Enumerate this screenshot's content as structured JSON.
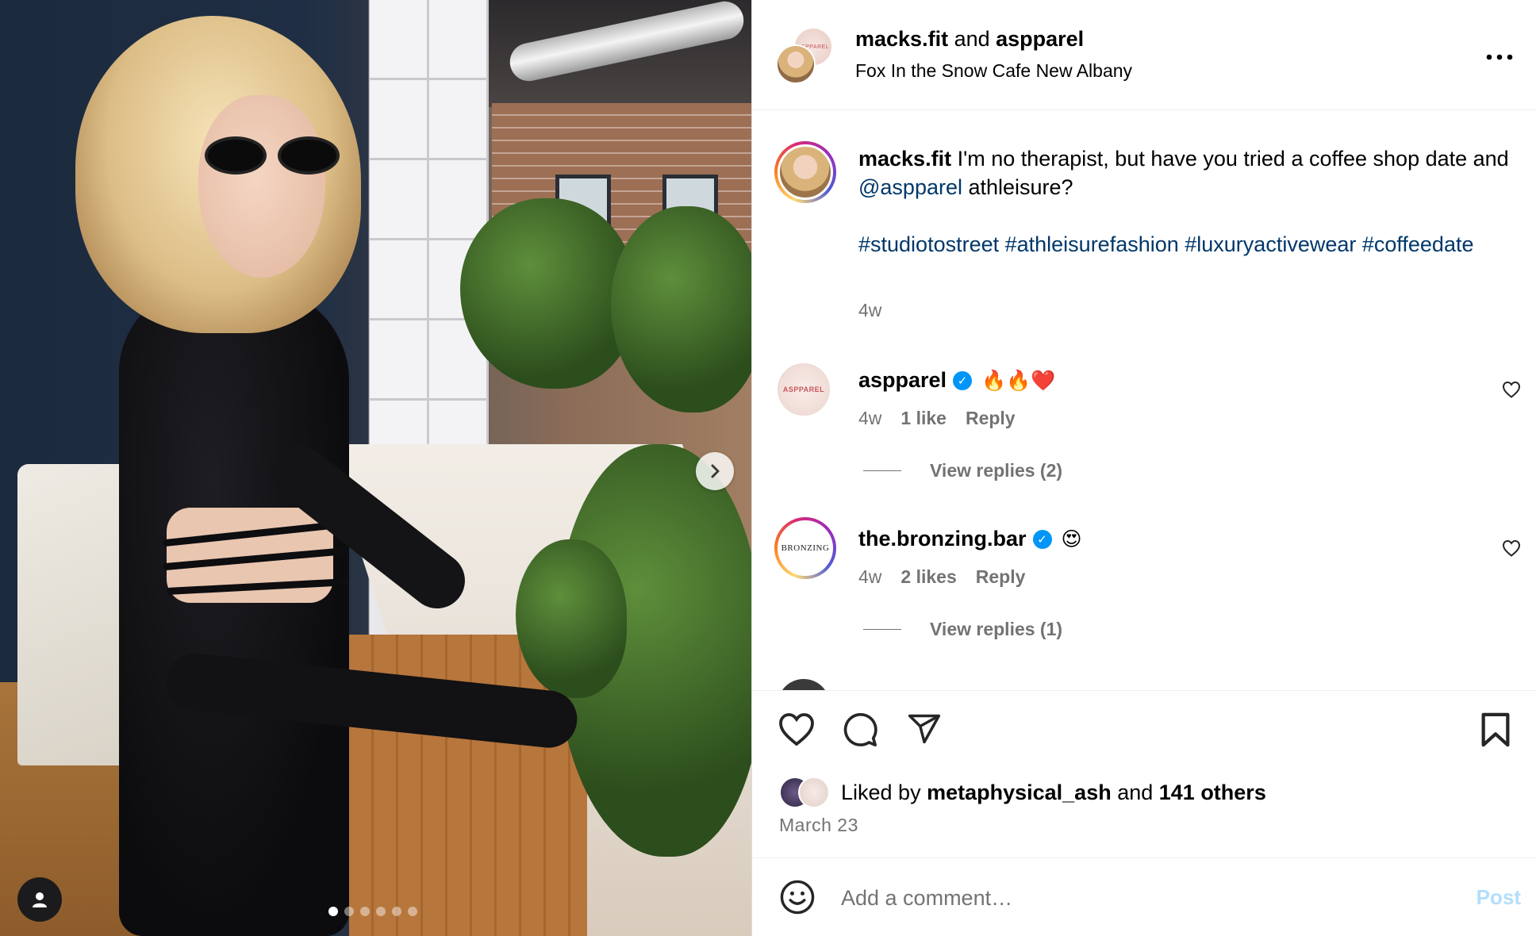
{
  "header": {
    "user1": "macks.fit",
    "joiner": " and ",
    "user2": "aspparel",
    "location": "Fox In the Snow Cafe New Albany",
    "more_label": "•••",
    "collab_avatar_text": "ASPPAREL"
  },
  "photo": {
    "slide_count": 6,
    "active_slide": 1
  },
  "caption": {
    "username": "macks.fit",
    "text_before": " I'm no therapist, but have you tried a coffee shop date and ",
    "mention": "@aspparel",
    "text_after": " athleisure?",
    "hashtags": "#studiotostreet #athleisurefashion #luxuryactivewear #coffeedate",
    "time": "4w"
  },
  "comments": [
    {
      "username": "aspparel",
      "verified": true,
      "text": "🔥🔥❤️",
      "avatar_text": "ASPPAREL",
      "time": "4w",
      "likes": "1 like",
      "reply_label": "Reply",
      "view_replies": "View replies (2)"
    },
    {
      "username": "the.bronzing.bar",
      "verified": true,
      "text": "😍",
      "avatar_text": "BRONZING",
      "time": "4w",
      "likes": "2 likes",
      "reply_label": "Reply",
      "view_replies": "View replies (1)"
    }
  ],
  "likes": {
    "prefix": "Liked by ",
    "user": "metaphysical_ash",
    "middle": " and ",
    "others": "141 others"
  },
  "post_date": "March 23",
  "composer": {
    "placeholder": "Add a comment…",
    "post_label": "Post"
  },
  "colors": {
    "link": "#00376b",
    "muted": "#737373",
    "verified": "#0095f6",
    "post_disabled": "#b2dffc"
  },
  "icons": [
    "chevron-right-icon",
    "user-tag-icon",
    "more-icon",
    "verified-icon",
    "heart-icon",
    "comment-icon",
    "share-icon",
    "bookmark-icon",
    "emoji-icon"
  ]
}
